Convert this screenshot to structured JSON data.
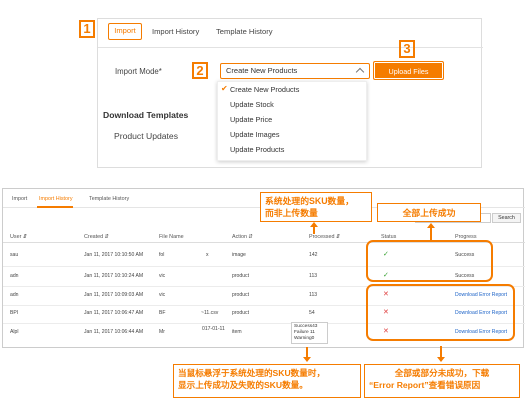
{
  "top": {
    "tabs": [
      "Import",
      "Import History",
      "Template History"
    ],
    "mode_label": "Import Mode*",
    "selected_mode": "Create New Products",
    "options": [
      "Create New Products",
      "Update Stock",
      "Update Price",
      "Update Images",
      "Update Products"
    ],
    "download_title": "Download Templates",
    "download_item": "Product Updates",
    "upload_label": "Upload Files",
    "step_numbers": [
      "1",
      "2",
      "3"
    ]
  },
  "bottom": {
    "tabs": [
      "Import",
      "Import History",
      "Template History"
    ],
    "search_label": "Search",
    "columns": [
      "User",
      "Created",
      "File Name",
      "Action",
      "Processed",
      "Status",
      "Progress"
    ],
    "rows": [
      {
        "user": "sau",
        "created": "Jan 11, 2017 10:10:50 AM",
        "file": "fol",
        "file_extra": "x",
        "action": "image",
        "processed": "142",
        "status": "ok",
        "progress": "Success"
      },
      {
        "user": "adn",
        "created": "Jan 11, 2017 10:10:24 AM",
        "file": "vic",
        "file_extra": "",
        "action": "product",
        "processed": "113",
        "status": "ok",
        "progress": "Success"
      },
      {
        "user": "adn",
        "created": "Jan 11, 2017 10:09:03 AM",
        "file": "vic",
        "file_extra": "",
        "action": "product",
        "processed": "113",
        "status": "bad",
        "progress": "Download Error Report"
      },
      {
        "user": "BPI",
        "created": "Jan 11, 2017 10:06:47 AM",
        "file": "BF",
        "file_extra": "~11.csv",
        "action": "product",
        "processed": "54",
        "status": "bad",
        "progress": "Download Error Report"
      },
      {
        "user": "Alpl",
        "created": "Jan 11, 2017 10:06:44 AM",
        "file": "Mr",
        "file_extra": "017-01-11",
        "action": "item",
        "processed": "",
        "status": "bad",
        "progress": "Download Error Report"
      }
    ],
    "tooltip": [
      "Success43",
      "Failure 11",
      "Warning0"
    ]
  },
  "annotations": {
    "processed_note": [
      "系统处理的SKU数量，",
      "而非上传数量"
    ],
    "success_note": "全部上传成功",
    "hover_note": [
      "当鼠标悬浮于系统处理的SKU数量时，",
      "显示上传成功及失败的SKU数量。"
    ],
    "error_note": [
      "全部或部分未成功，下载",
      "“Error Report”查看错误原因"
    ]
  },
  "colors": {
    "accent": "#f57c00",
    "success": "#3aa335",
    "error": "#e03e3e",
    "link": "#1e64c8"
  }
}
